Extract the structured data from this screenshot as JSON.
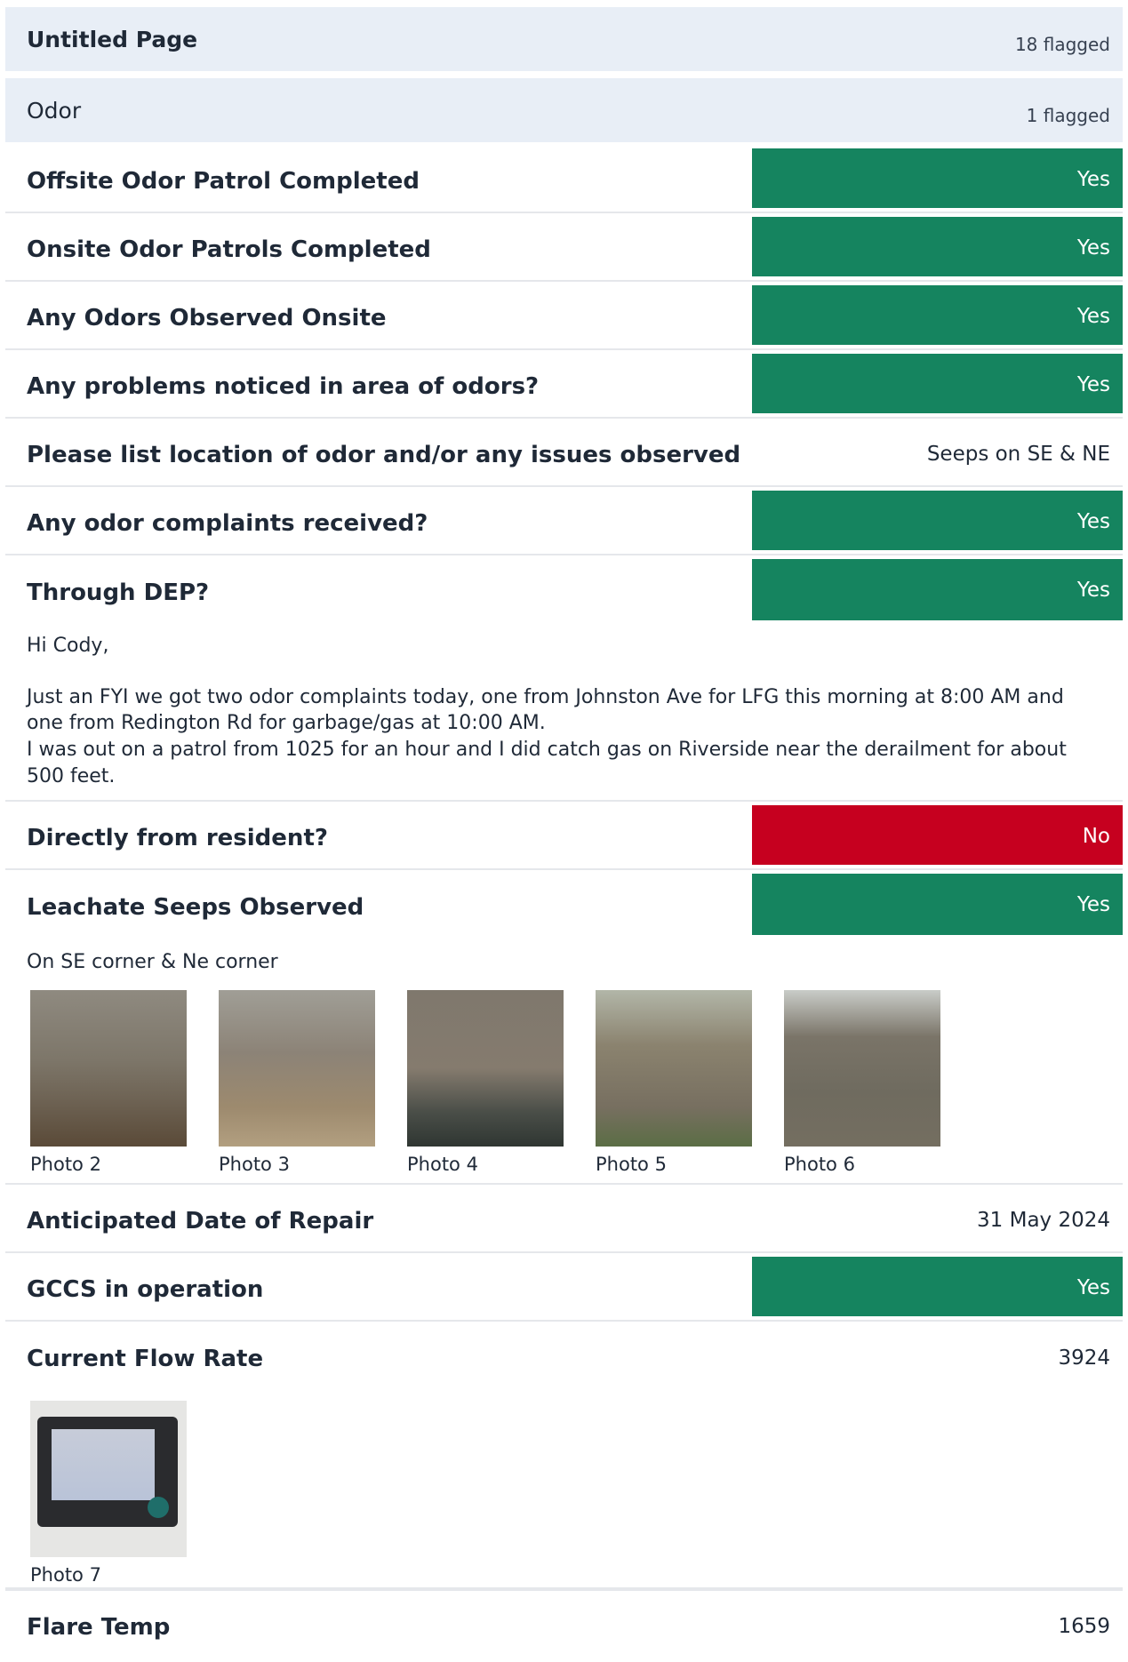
{
  "header": {
    "title": "Untitled Page",
    "flag_count": "18 flagged"
  },
  "section": {
    "title": "Odor",
    "flag_count": "1 flagged"
  },
  "rows": {
    "offsite_patrol": {
      "label": "Offsite Odor Patrol Completed",
      "value": "Yes"
    },
    "onsite_patrols": {
      "label": "Onsite Odor Patrols Completed",
      "value": "Yes"
    },
    "odors_onsite": {
      "label": "Any Odors Observed Onsite",
      "value": "Yes"
    },
    "problems_area": {
      "label": "Any problems noticed in area of odors?",
      "value": "Yes"
    },
    "odor_location": {
      "label": "Please list location of odor and/or any issues observed",
      "value": "Seeps on SE & NE"
    },
    "complaints": {
      "label": "Any odor complaints received?",
      "value": "Yes"
    },
    "through_dep": {
      "label": "Through DEP?",
      "value": "Yes"
    },
    "from_resident": {
      "label": "Directly from resident?",
      "value": "No"
    },
    "leachate": {
      "label": "Leachate Seeps Observed",
      "value": "Yes"
    },
    "repair_date": {
      "label": "Anticipated Date of Repair",
      "value": "31 May 2024"
    },
    "gccs": {
      "label": "GCCS in operation",
      "value": "Yes"
    },
    "flow_rate": {
      "label": "Current Flow Rate",
      "value": "3924"
    },
    "flare_temp": {
      "label": "Flare Temp",
      "value": "1659"
    }
  },
  "dep_note": {
    "greeting": "Hi Cody,",
    "line1": "Just an FYI we got two odor complaints today, one from Johnston Ave for LFG this morning at 8:00 AM and one from Redington Rd for garbage/gas at 10:00 AM.",
    "line2": "I was out on a patrol from 1025 for an hour and I did catch gas on Riverside near the derailment for about 500 feet."
  },
  "leachate_note": "On SE corner & Ne corner",
  "leachate_photos": [
    "Photo 2",
    "Photo 3",
    "Photo 4",
    "Photo 5",
    "Photo 6"
  ],
  "flow_photos": [
    "Photo 7"
  ],
  "colors": {
    "yes": "#15845f",
    "no": "#c6001f",
    "section_bg": "#e8eef6"
  }
}
